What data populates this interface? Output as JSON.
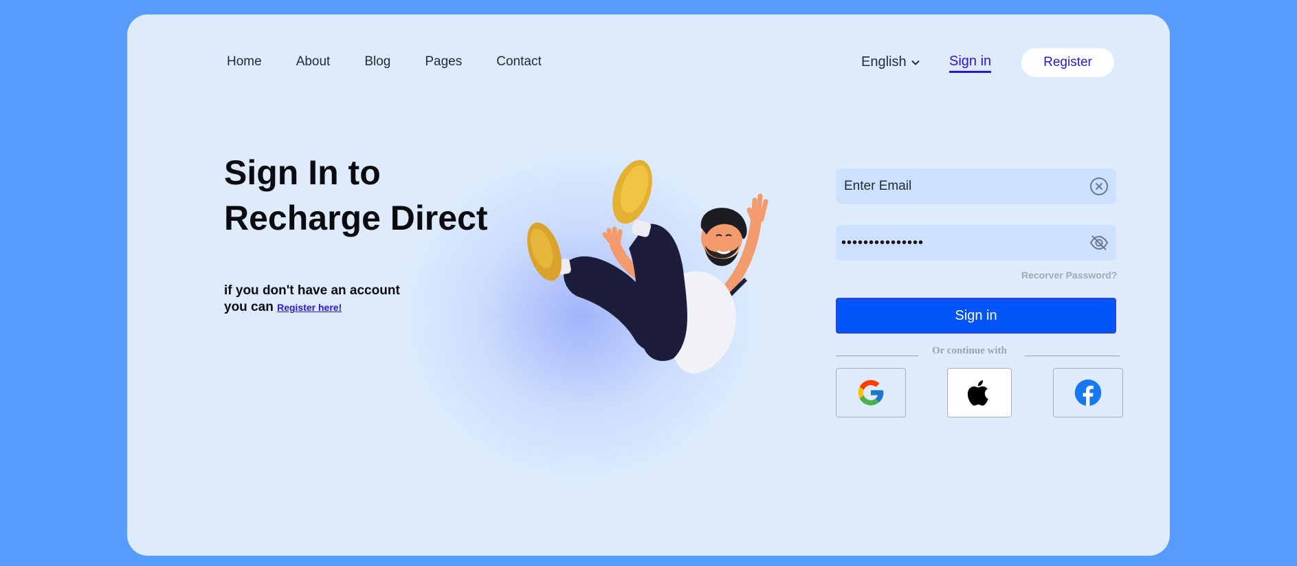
{
  "nav": {
    "items": [
      "Home",
      "About",
      "Blog",
      "Pages",
      "Contact"
    ]
  },
  "header": {
    "language": "English",
    "signin_label": "Sign in",
    "register_label": "Register"
  },
  "hero": {
    "title_line1": "Sign In to",
    "title_line2": "Recharge Direct",
    "sub_line1": "if you don't have an account",
    "sub_line2": "you can",
    "register_link": "Register here!"
  },
  "form": {
    "email_placeholder": "Enter Email",
    "password_dots": "•••••••••••••••",
    "recover_label": "Recorver Password?",
    "signin_button": "Sign in",
    "divider_text": "Or continue with"
  },
  "social": [
    "google-icon",
    "apple-icon",
    "facebook-icon"
  ],
  "colors": {
    "background": "#559cfe",
    "card": "#ddebfd",
    "primary": "#0255f9",
    "link": "#2a16d8"
  }
}
